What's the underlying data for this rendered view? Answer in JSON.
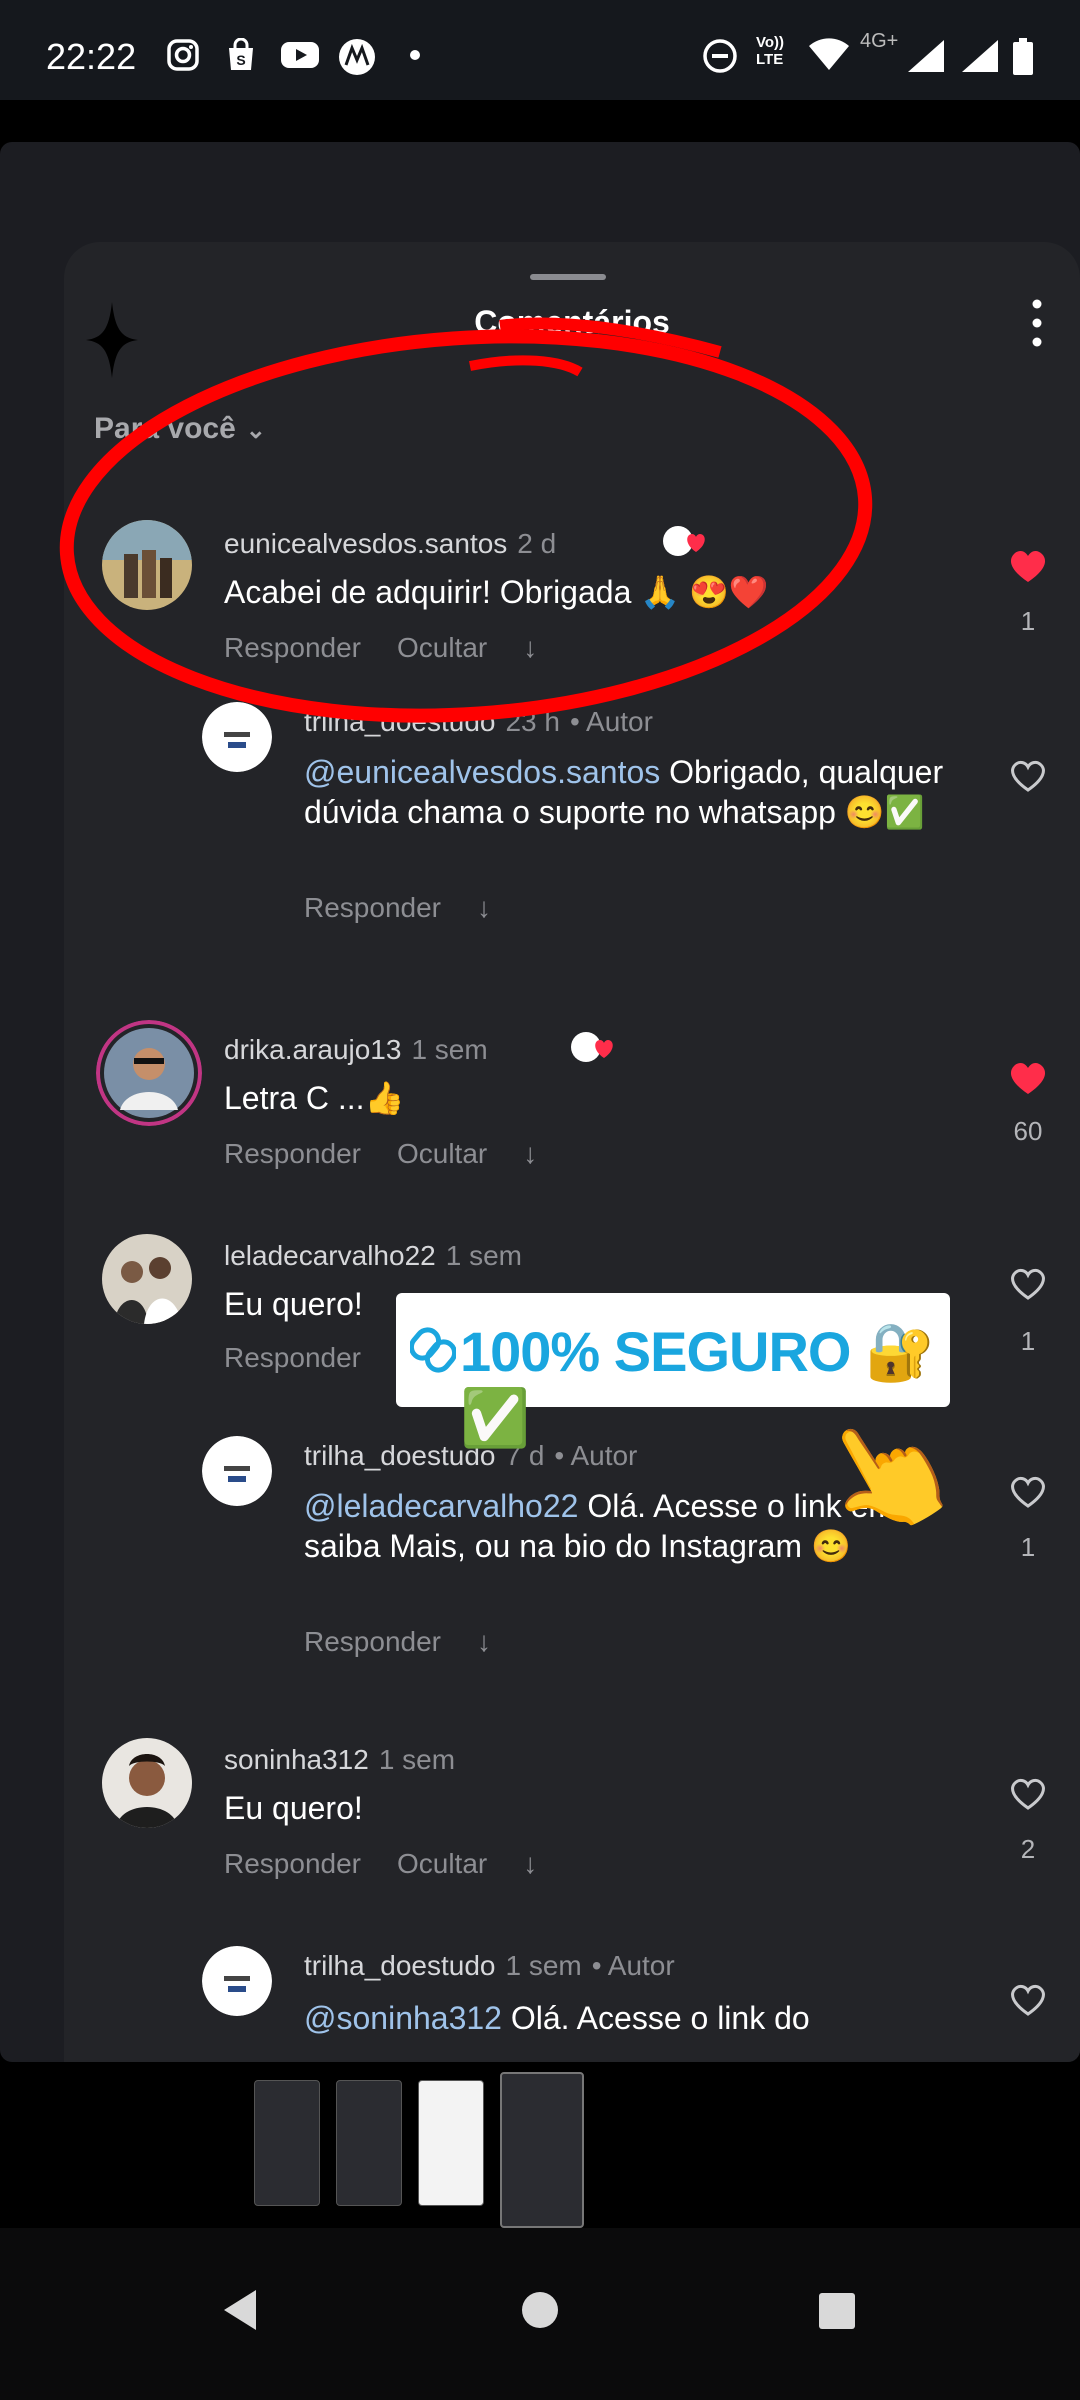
{
  "status_bar": {
    "time": "22:22",
    "left_icons": [
      "instagram-icon",
      "shopping-bag-icon",
      "youtube-icon",
      "motorola-icon",
      "dot-icon"
    ],
    "right_icons": [
      "do-not-disturb-icon",
      "volte-icon",
      "wifi-icon",
      "signal-icon",
      "signal-icon",
      "battery-icon"
    ],
    "volte_label": "Vo)) LTE",
    "network_label": "4G+"
  },
  "sheet": {
    "title": "Comentários",
    "filter_label": "Para você",
    "filter_chevron": "⌄"
  },
  "comments": [
    {
      "username": "eunicealvesdos.santos",
      "age": "2 d",
      "text": "Acabei de adquirir! Obrigada 🙏 😍❤️",
      "actions": [
        "Responder",
        "Ocultar",
        "↓"
      ],
      "liked": true,
      "likes": "1"
    },
    {
      "username": "trilha_doestudo",
      "age": "23 h",
      "author_tag": "• Autor",
      "mention": "@eunicealvesdos.santos",
      "text": " Obrigado, qualquer dúvida chama o suporte no whatsapp 😊✅",
      "actions": [
        "Responder",
        "↓"
      ],
      "liked": false,
      "likes": ""
    },
    {
      "username": "drika.araujo13",
      "age": "1 sem",
      "text": "Letra C ...👍",
      "actions": [
        "Responder",
        "Ocultar",
        "↓"
      ],
      "liked": true,
      "likes": "60"
    },
    {
      "username": "leladecarvalho22",
      "age": "1 sem",
      "text": "Eu quero!",
      "actions": [
        "Responder"
      ],
      "liked": false,
      "likes": "1"
    },
    {
      "username": "trilha_doestudo",
      "age": "7 d",
      "author_tag": "• Autor",
      "mention": "@leladecarvalho22",
      "text": " Olá. Acesse o link em saiba Mais, ou na bio do Instagram 😊",
      "actions": [
        "Responder",
        "↓"
      ],
      "liked": false,
      "likes": "1"
    },
    {
      "username": "soninha312",
      "age": "1 sem",
      "text": "Eu quero!",
      "actions": [
        "Responder",
        "Ocultar",
        "↓"
      ],
      "liked": false,
      "likes": "2"
    },
    {
      "username": "trilha_doestudo",
      "age": "1 sem",
      "author_tag": "• Autor",
      "mention": "@soninha312",
      "text": " Olá. Acesse o link do",
      "actions": [],
      "liked": false,
      "likes": ""
    }
  ],
  "sticker": {
    "text": "100% SEGURO 🔐✅",
    "link_icon": "🔗",
    "pointer_emoji": "👆"
  },
  "thumbnails": [
    "thumb-1",
    "thumb-2",
    "thumb-3",
    "thumb-4"
  ],
  "colors": {
    "heart_liked": "#ff2d4a",
    "mention": "#9fc3ea",
    "sticker_text": "#1aa6df",
    "annotation_red": "#ff0000"
  }
}
